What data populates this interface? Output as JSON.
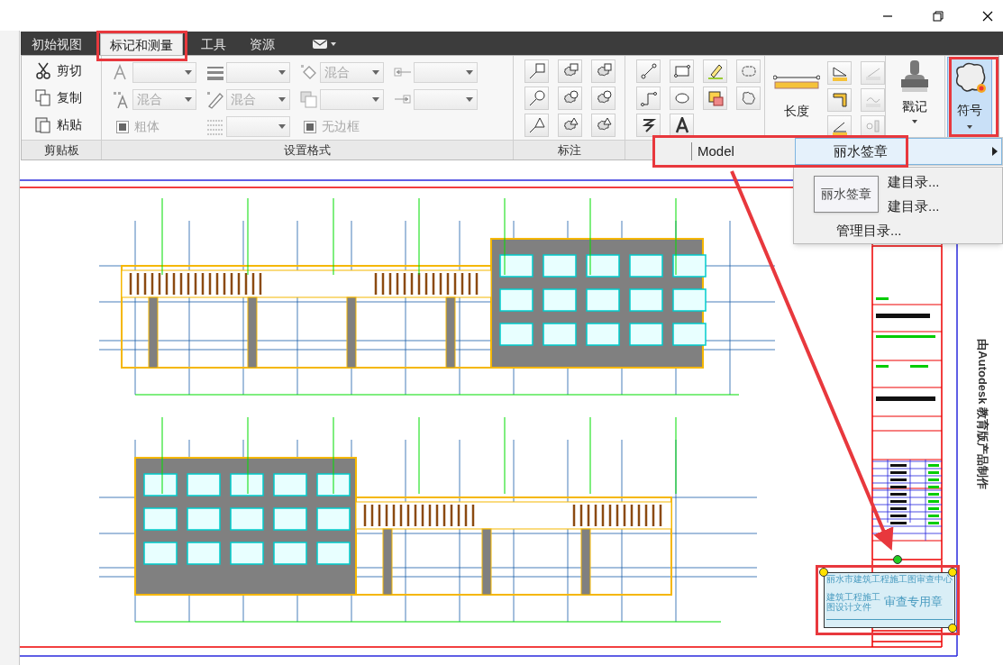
{
  "tabs": [
    {
      "label": "初始视图",
      "selected": false
    },
    {
      "label": "标记和测量",
      "selected": true
    },
    {
      "label": "工具",
      "selected": false
    },
    {
      "label": "资源",
      "selected": false
    }
  ],
  "clipboard": {
    "label": "剪贴板",
    "items": [
      {
        "label": "剪切",
        "kind": "cut"
      },
      {
        "label": "复制",
        "kind": "copy"
      },
      {
        "label": "粘贴",
        "kind": "paste"
      }
    ]
  },
  "format": {
    "label": "设置格式",
    "disabled": true,
    "cells": [
      {
        "kind": "dropdown"
      },
      {
        "kind": "dropdown"
      },
      {
        "kind": "dropdown",
        "value": "混合"
      },
      {
        "kind": "dropdown"
      },
      {
        "kind": "dropdown",
        "value": "混合"
      },
      {
        "kind": "dropdown",
        "value": "混合"
      },
      {
        "kind": "dropdown"
      },
      {
        "kind": "dropdown"
      },
      {
        "kind": "checkbox",
        "label": "粗体",
        "checked": true
      },
      {
        "kind": "dropdown"
      },
      {
        "kind": "checkbox",
        "label": "无边框",
        "checked": true
      }
    ]
  },
  "markup": {
    "label": "标注"
  },
  "measure": {
    "label": "长度"
  },
  "stamp": {
    "label": "戳记"
  },
  "symbol": {
    "label": "符号",
    "selected": true
  },
  "menu": {
    "items": [
      {
        "label": "Model",
        "selected": false
      },
      {
        "label": "丽水签章",
        "selected": true
      }
    ],
    "submenu": [
      "建目录...",
      "建目录...",
      "管理目录..."
    ],
    "tooltip": "丽水签章"
  },
  "drawing": {
    "stamp_lines": [
      "丽水市建筑工程施工图审查中心",
      "建筑工程施工",
      "图设计文件",
      "审查专用章"
    ],
    "watermark": "由Autodesk 教育版产品制作"
  }
}
